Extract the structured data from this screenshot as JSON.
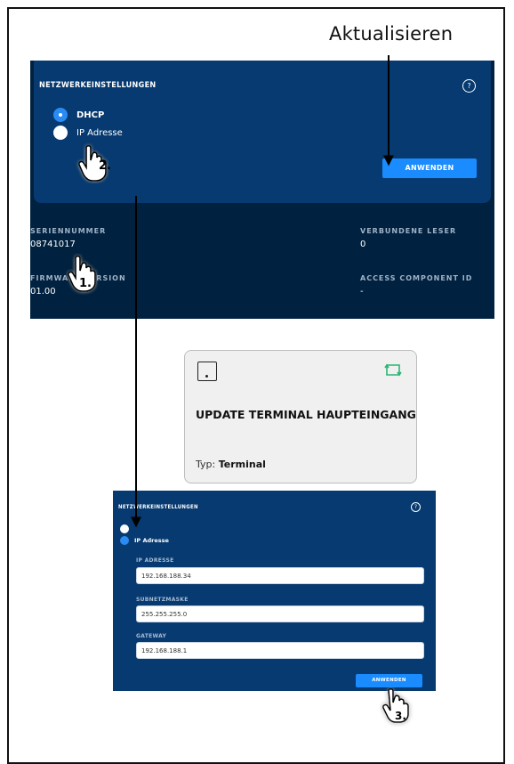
{
  "callout": {
    "label": "Aktualisieren"
  },
  "top_panel": {
    "section_title": "NETZWERKEINSTELLUNGEN",
    "help_label": "?",
    "radio_dhcp": "DHCP",
    "radio_ip": "IP Adresse",
    "apply_button": "ANWENDEN",
    "serial_label": "SERIENNUMMER",
    "serial_value": "08741017",
    "firmware_label": "FIRMWARE VERSION",
    "firmware_value": "01.00",
    "readers_label": "VERBUNDENE LESER",
    "readers_value": "0",
    "access_label": "ACCESS COMPONENT ID",
    "access_value": "-"
  },
  "tile": {
    "title": "UPDATE TERMINAL HAUPTEINGANG",
    "type_prefix": "Typ: ",
    "type_value": "Terminal",
    "accent": "#2bb673"
  },
  "bottom_panel": {
    "section_title": "NETZWERKEINSTELLUNGEN",
    "help_label": "?",
    "radio_ip": "IP Adresse",
    "ip_label": "IP ADRESSE",
    "ip_value": "192.168.188.34",
    "subnet_label": "SUBNETZMASKE",
    "subnet_value": "255.255.255.0",
    "gateway_label": "GATEWAY",
    "gateway_value": "192.168.188.1",
    "apply_button": "ANWENDEN"
  },
  "steps": {
    "one": "1.",
    "two": "2.",
    "three": "3."
  },
  "colors": {
    "panel_dark": "#00213f",
    "panel_blue": "#063a70",
    "button": "#1a8cff"
  }
}
